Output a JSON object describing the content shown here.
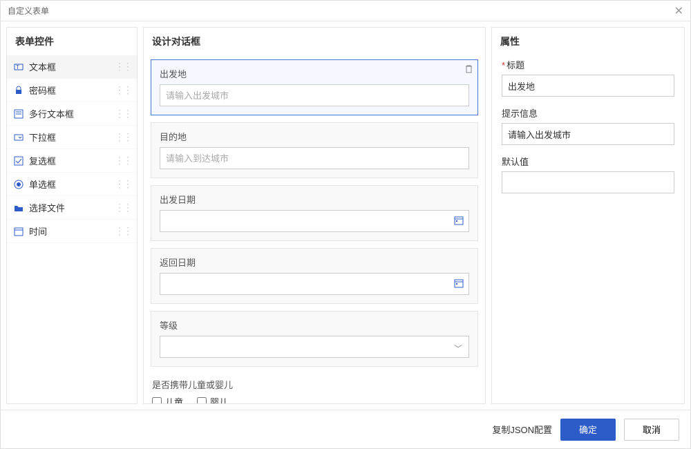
{
  "window": {
    "title": "自定义表单"
  },
  "widgets": {
    "heading": "表单控件",
    "items": [
      {
        "label": "文本框"
      },
      {
        "label": "密码框"
      },
      {
        "label": "多行文本框"
      },
      {
        "label": "下拉框"
      },
      {
        "label": "复选框"
      },
      {
        "label": "单选框"
      },
      {
        "label": "选择文件"
      },
      {
        "label": "时间"
      }
    ]
  },
  "design": {
    "heading": "设计对话框",
    "fields": {
      "origin": {
        "label": "出发地",
        "placeholder": "请输入出发城市"
      },
      "dest": {
        "label": "目的地",
        "placeholder": "请输入到达城市"
      },
      "depart": {
        "label": "出发日期"
      },
      "return": {
        "label": "返回日期"
      },
      "class": {
        "label": "等级"
      },
      "children": {
        "label": "是否携带儿童或婴儿",
        "opt1": "儿童",
        "opt2": "婴儿"
      }
    }
  },
  "props": {
    "heading": "属性",
    "title_label": "标题",
    "title_value": "出发地",
    "hint_label": "提示信息",
    "hint_value": "请输入出发城市",
    "default_label": "默认值",
    "default_value": ""
  },
  "footer": {
    "copy_json": "复制JSON配置",
    "ok": "确定",
    "cancel": "取消"
  }
}
